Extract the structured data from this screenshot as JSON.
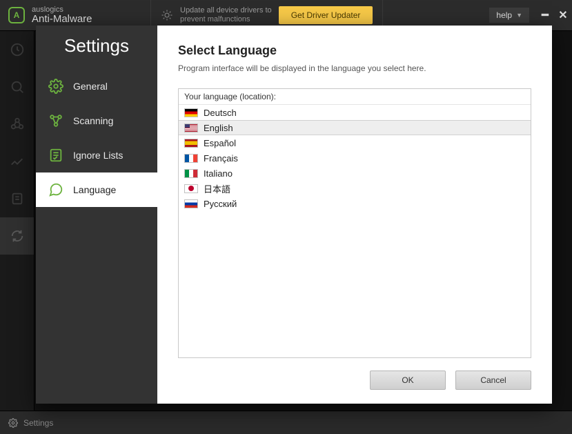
{
  "header": {
    "brand_small": "auslogics",
    "brand_big": "Anti-Malware",
    "promo_line1": "Update all device drivers to",
    "promo_line2": "prevent malfunctions",
    "updater_btn": "Get Driver Updater",
    "help_label": "help"
  },
  "statusbar": {
    "label": "Settings"
  },
  "modal": {
    "title": "Settings",
    "nav": {
      "general": "General",
      "scanning": "Scanning",
      "ignore": "Ignore Lists",
      "language": "Language"
    },
    "body": {
      "heading": "Select Language",
      "desc": "Program interface will be displayed in the language you select here.",
      "list_label": "Your language (location):"
    },
    "languages": {
      "de": "Deutsch",
      "en": "English",
      "es": "Español",
      "fr": "Français",
      "it": "Italiano",
      "ja": "日本語",
      "ru": "Русский"
    },
    "selected_language": "en",
    "buttons": {
      "ok": "OK",
      "cancel": "Cancel"
    }
  }
}
